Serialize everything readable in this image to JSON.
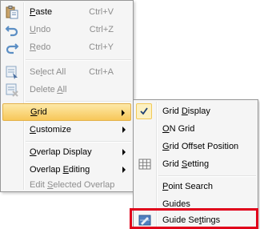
{
  "main_menu": {
    "paste": {
      "pre": "",
      "key": "P",
      "post": "aste",
      "shortcut": "Ctrl+V"
    },
    "undo": {
      "pre": "",
      "key": "U",
      "post": "ndo",
      "shortcut": "Ctrl+Z"
    },
    "redo": {
      "pre": "",
      "key": "R",
      "post": "edo",
      "shortcut": "Ctrl+Y"
    },
    "select_all": {
      "pre": "Se",
      "key": "l",
      "post": "ect All",
      "shortcut": "Ctrl+A"
    },
    "delete_all": {
      "pre": "Delete ",
      "key": "A",
      "post": "ll"
    },
    "grid": {
      "pre": "",
      "key": "G",
      "post": "rid"
    },
    "customize": {
      "pre": "",
      "key": "C",
      "post": "ustomize"
    },
    "overlap_display": {
      "pre": "",
      "key": "O",
      "post": "verlap Display"
    },
    "overlap_editing": {
      "pre": "Overlap ",
      "key": "E",
      "post": "diting"
    },
    "edit_selected_overlap": {
      "pre": "Edit ",
      "key": "S",
      "post": "elected Overlap"
    }
  },
  "grid_submenu": {
    "grid_display": {
      "pre": "Grid ",
      "key": "D",
      "post": "isplay"
    },
    "on_grid": {
      "pre": "",
      "key": "O",
      "post": "N Grid"
    },
    "grid_offset_position": {
      "pre": "",
      "key": "G",
      "post": "rid Offset Position"
    },
    "grid_setting": {
      "pre": "Grid ",
      "key": "S",
      "post": "etting"
    },
    "point_search": {
      "pre": "",
      "key": "P",
      "post": "oint Search"
    },
    "guides": {
      "pre": "Guides",
      "key": "",
      "post": ""
    },
    "guide_settings": {
      "pre": "Guide Se",
      "key": "t",
      "post": "tings"
    }
  },
  "colors": {
    "highlight": "#f7c759",
    "focus_rect": "#e0001a",
    "disabled_text": "#8d8d8d"
  }
}
